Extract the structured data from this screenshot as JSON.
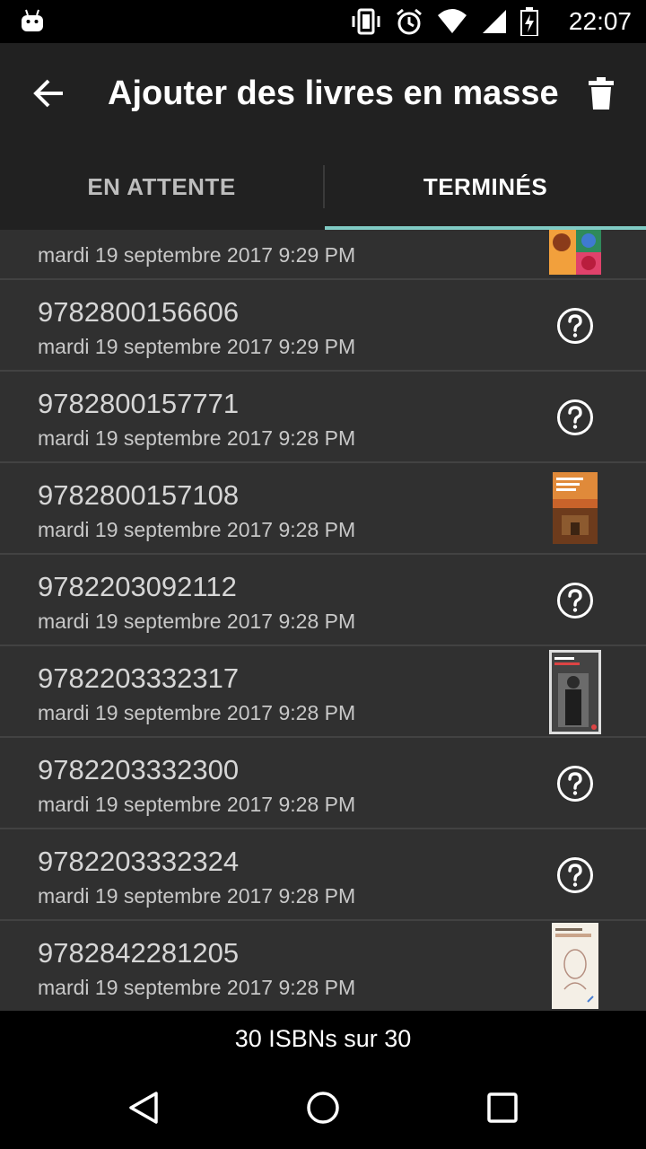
{
  "status_bar": {
    "time": "22:07",
    "icons": [
      "android-icon",
      "vibrate-icon",
      "alarm-icon",
      "wifi-icon",
      "signal-icon",
      "battery-icon"
    ]
  },
  "app_bar": {
    "title": "Ajouter des livres en masse",
    "back_icon": "arrow-back-icon",
    "action_icon": "trash-icon"
  },
  "tabs": [
    {
      "label": "EN ATTENTE",
      "selected": false
    },
    {
      "label": "TERMINÉS",
      "selected": true
    }
  ],
  "accent_color": "#80cbc4",
  "list": {
    "items": [
      {
        "isbn": "",
        "date": "mardi 19 septembre 2017 9:29 PM",
        "cover": "cover-image"
      },
      {
        "isbn": "9782800156606",
        "date": "mardi 19 septembre 2017 9:29 PM",
        "cover": "unknown-cover-icon"
      },
      {
        "isbn": "9782800157771",
        "date": "mardi 19 septembre 2017 9:28 PM",
        "cover": "unknown-cover-icon"
      },
      {
        "isbn": "9782800157108",
        "date": "mardi 19 septembre 2017 9:28 PM",
        "cover": "cover-image"
      },
      {
        "isbn": "9782203092112",
        "date": "mardi 19 septembre 2017 9:28 PM",
        "cover": "unknown-cover-icon"
      },
      {
        "isbn": "9782203332317",
        "date": "mardi 19 septembre 2017 9:28 PM",
        "cover": "cover-image"
      },
      {
        "isbn": "9782203332300",
        "date": "mardi 19 septembre 2017 9:28 PM",
        "cover": "unknown-cover-icon"
      },
      {
        "isbn": "9782203332324",
        "date": "mardi 19 septembre 2017 9:28 PM",
        "cover": "unknown-cover-icon"
      },
      {
        "isbn": "9782842281205",
        "date": "mardi 19 septembre 2017 9:28 PM",
        "cover": "cover-image"
      }
    ]
  },
  "footer": {
    "count_text": "30 ISBNs sur 30"
  },
  "nav_bar": {
    "buttons": [
      "back-triangle-icon",
      "home-circle-icon",
      "recents-square-icon"
    ]
  }
}
